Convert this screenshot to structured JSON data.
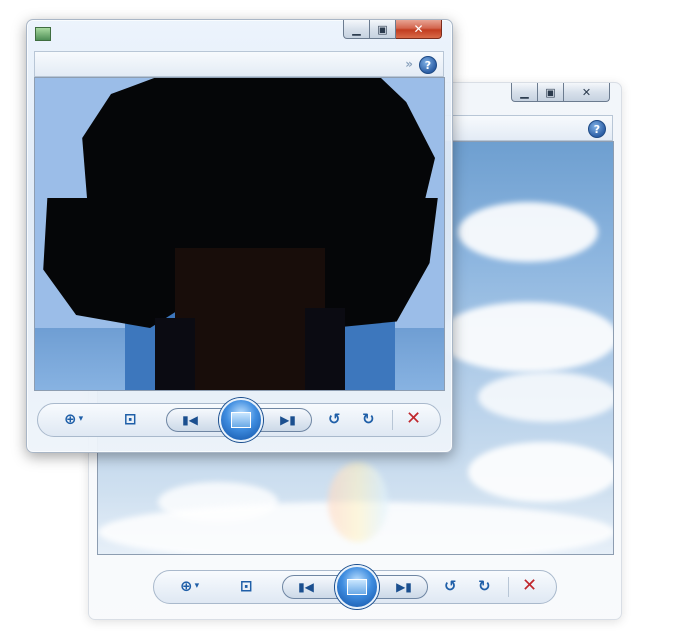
{
  "front_window": {
    "caption": {
      "minimize_icon": "minimize-icon",
      "maximize_icon": "maximize-icon",
      "close_icon": "close-icon"
    },
    "app_icon": "photo-viewer-app-icon",
    "toolbar": {
      "overflow_icon": "chevrons-icon",
      "help_label": "?"
    },
    "image": "pixelated-portrait"
  },
  "back_window": {
    "caption": {
      "minimize_icon": "minimize-icon",
      "maximize_icon": "maximize-icon",
      "close_icon": "close-icon"
    },
    "toolbar": {
      "help_label": "?"
    },
    "image": "clouds-sky"
  },
  "controls": {
    "zoom_icon": "zoom-icon",
    "zoom_dropdown_icon": "chevron-down-icon",
    "actual_size_icon": "actual-size-icon",
    "previous_icon": "previous-icon",
    "slideshow_icon": "slideshow-icon",
    "next_icon": "next-icon",
    "rotate_ccw_icon": "rotate-counterclockwise-icon",
    "rotate_cw_icon": "rotate-clockwise-icon",
    "delete_icon": "delete-icon"
  },
  "colors": {
    "accent": "#1f5fa8",
    "close_red": "#c23c20",
    "delete_red": "#c0272d"
  }
}
